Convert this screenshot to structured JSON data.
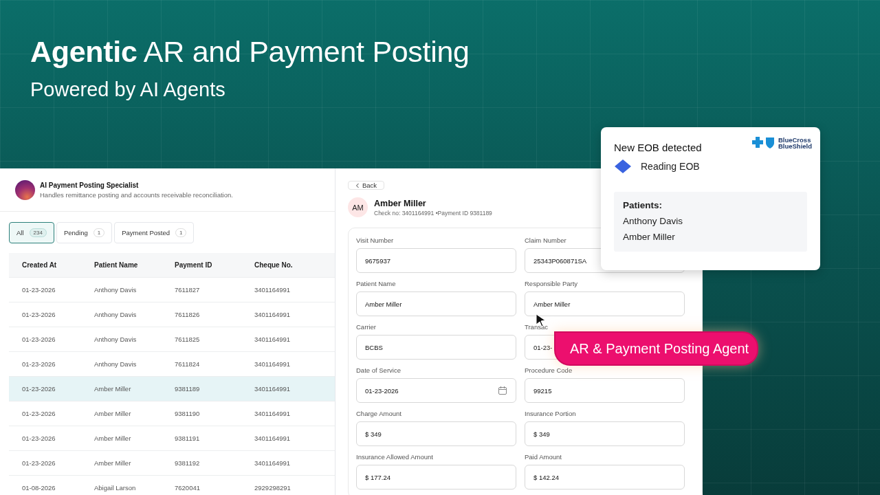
{
  "hero": {
    "title": "**Agentic** AR and Payment Posting",
    "subtitle": "Powered by AI Agents"
  },
  "agent": {
    "name": "AI Payment Posting Specialist",
    "description": "Handles remittance posting and accounts receivable reconciliation."
  },
  "tabs": [
    {
      "label": "All",
      "count": "234",
      "selected": true
    },
    {
      "label": "Pending",
      "count": "1",
      "selected": false
    },
    {
      "label": "Payment Posted",
      "count": "1",
      "selected": false
    }
  ],
  "table": {
    "columns": [
      "Created At",
      "Patient Name",
      "Payment ID",
      "Cheque No."
    ],
    "rows": [
      {
        "cells": [
          "01-23-2026",
          "Anthony Davis",
          "7611827",
          "3401164991"
        ],
        "selected": false
      },
      {
        "cells": [
          "01-23-2026",
          "Anthony Davis",
          "7611826",
          "3401164991"
        ],
        "selected": false
      },
      {
        "cells": [
          "01-23-2026",
          "Anthony Davis",
          "7611825",
          "3401164991"
        ],
        "selected": false
      },
      {
        "cells": [
          "01-23-2026",
          "Anthony Davis",
          "7611824",
          "3401164991"
        ],
        "selected": false
      },
      {
        "cells": [
          "01-23-2026",
          "Amber Miller",
          "9381189",
          "3401164991"
        ],
        "selected": true
      },
      {
        "cells": [
          "01-23-2026",
          "Amber Miller",
          "9381190",
          "3401164991"
        ],
        "selected": false
      },
      {
        "cells": [
          "01-23-2026",
          "Amber Miller",
          "9381191",
          "3401164991"
        ],
        "selected": false
      },
      {
        "cells": [
          "01-23-2026",
          "Amber Miller",
          "9381192",
          "3401164991"
        ],
        "selected": false
      },
      {
        "cells": [
          "01-08-2026",
          "Abigail Larson",
          "7620041",
          "2929298291"
        ],
        "selected": false
      }
    ]
  },
  "detail": {
    "back": "Back",
    "initials": "AM",
    "name": "Amber Miller",
    "meta": "Check no: 3401164991 •Payment ID 9381189",
    "fields": [
      {
        "label": "Visit Number",
        "value": "9675937",
        "kind": "text"
      },
      {
        "label": "Claim Number",
        "value": "25343P060871SA",
        "kind": "text"
      },
      {
        "label": "Patient Name",
        "value": "Amber Miller",
        "kind": "text"
      },
      {
        "label": "Responsible Party",
        "value": "Amber Miller",
        "kind": "text"
      },
      {
        "label": "Carrier",
        "value": "BCBS",
        "kind": "text"
      },
      {
        "label": "Transac",
        "value": "01-23-",
        "kind": "text"
      },
      {
        "label": "Date of Service",
        "value": "01-23-2026",
        "kind": "date"
      },
      {
        "label": "Procedure Code",
        "value": "99215",
        "kind": "text"
      },
      {
        "label": "Charge Amount",
        "value": "$ 349",
        "kind": "text"
      },
      {
        "label": "Insurance Portion",
        "value": "$ 349",
        "kind": "text"
      },
      {
        "label": "Insurance Allowed Amount",
        "value": "$ 177.24",
        "kind": "text"
      },
      {
        "label": "Paid Amount",
        "value": "$ 142.24",
        "kind": "text"
      }
    ]
  },
  "eob": {
    "title": "New EOB detected",
    "logo": [
      "BlueCross",
      "BlueShield"
    ],
    "status": "Reading EOB",
    "patients_label": "Patients:",
    "patients": [
      "Anthony Davis",
      "Amber Miller"
    ]
  },
  "agent_tag": "AR & Payment Posting Agent"
}
